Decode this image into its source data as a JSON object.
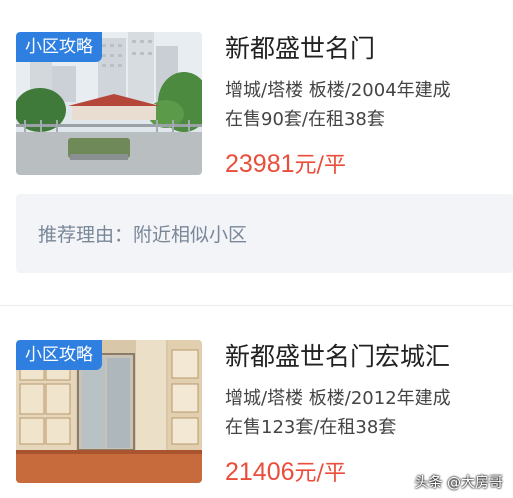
{
  "listings": [
    {
      "tag": "小区攻略",
      "name": "新都盛世名门",
      "meta_line1": "增城/塔楼 板楼/2004年建成",
      "meta_line2": "在售90套/在租38套",
      "price_number": "23981",
      "price_unit": "元/平"
    },
    {
      "tag": "小区攻略",
      "name": "新都盛世名门宏城汇",
      "meta_line1": "增城/塔楼 板楼/2012年建成",
      "meta_line2": "在售123套/在租38套",
      "price_number": "21406",
      "price_unit": "元/平"
    }
  ],
  "recommendation": {
    "text": "推荐理由：附近相似小区"
  },
  "watermark": "头条 @大房哥",
  "colors": {
    "tag_bg": "#2f7fe0",
    "price": "#ea4d3a",
    "reason_bg": "#f2f4f8",
    "reason_text": "#7a8799"
  }
}
